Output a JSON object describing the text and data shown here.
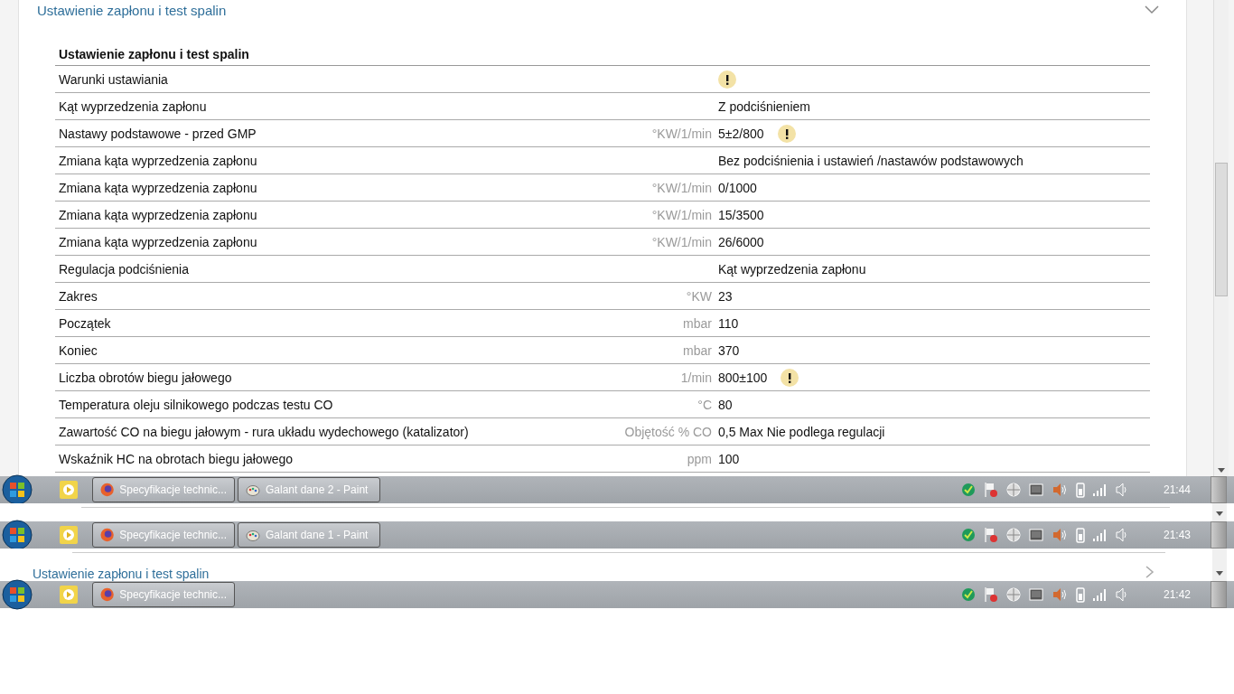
{
  "section": {
    "title": "Ustawienie zapłonu i test spalin",
    "table": {
      "title": "Ustawienie zapłonu i test spalin",
      "rows": [
        {
          "label": "Warunki ustawiania",
          "warning": true
        },
        {
          "label": "Kąt wyprzedzenia zapłonu",
          "value": "Z podciśnieniem",
          "warning": false
        },
        {
          "label": "Nastawy podstawowe - przed GMP",
          "unit": "°KW/1/min",
          "value": "5±2/800",
          "warning": true
        },
        {
          "label": "Zmiana kąta wyprzedzenia zapłonu",
          "value": "Bez podciśnienia i ustawień /nastawów podstawowych",
          "warning": false
        },
        {
          "label": "Zmiana kąta wyprzedzenia zapłonu",
          "unit": "°KW/1/min",
          "value": "0/1000",
          "warning": false
        },
        {
          "label": "Zmiana kąta wyprzedzenia zapłonu",
          "unit": "°KW/1/min",
          "value": "15/3500",
          "warning": false
        },
        {
          "label": "Zmiana kąta wyprzedzenia zapłonu",
          "unit": "°KW/1/min",
          "value": "26/6000",
          "warning": false
        },
        {
          "label": "Regulacja podciśnienia",
          "value": "Kąt wyprzedzenia zapłonu",
          "warning": false
        },
        {
          "label": "Zakres",
          "unit": "°KW",
          "value": "23",
          "warning": false
        },
        {
          "label": "Początek",
          "unit": "mbar",
          "value": "110",
          "warning": false
        },
        {
          "label": "Koniec",
          "unit": "mbar",
          "value": "370",
          "warning": false
        },
        {
          "label": "Liczba obrotów biegu jałowego",
          "unit": "1/min",
          "value": "800±100",
          "warning": true
        },
        {
          "label": "Temperatura oleju silnikowego podczas testu CO",
          "unit": "°C",
          "value": "80",
          "warning": false
        },
        {
          "label": "Zawartość CO na biegu jałowym - rura układu wydechowego (katalizator)",
          "unit": "Objętość % CO",
          "value": "0,5 Max Nie podlega regulacji",
          "warning": false
        },
        {
          "label": "Wskaźnik HC na obrotach biegu jałowego",
          "unit": "ppm",
          "value": "100",
          "warning": false
        }
      ]
    }
  },
  "taskbars": [
    {
      "buttons": [
        {
          "kind": "browser",
          "label": "Specyfikacje technic..."
        },
        {
          "kind": "paint",
          "label": "Galant dane 2 - Paint"
        }
      ],
      "clock": "21:44"
    },
    {
      "buttons": [
        {
          "kind": "browser",
          "label": "Specyfikacje technic..."
        },
        {
          "kind": "paint",
          "label": "Galant dane 1 - Paint"
        }
      ],
      "clock": "21:43"
    },
    {
      "buttons": [
        {
          "kind": "browser",
          "label": "Specyfikacje technic..."
        }
      ],
      "clock": "21:42"
    }
  ],
  "lower_section": {
    "title": "Ustawienie zapłonu i test spalin"
  }
}
